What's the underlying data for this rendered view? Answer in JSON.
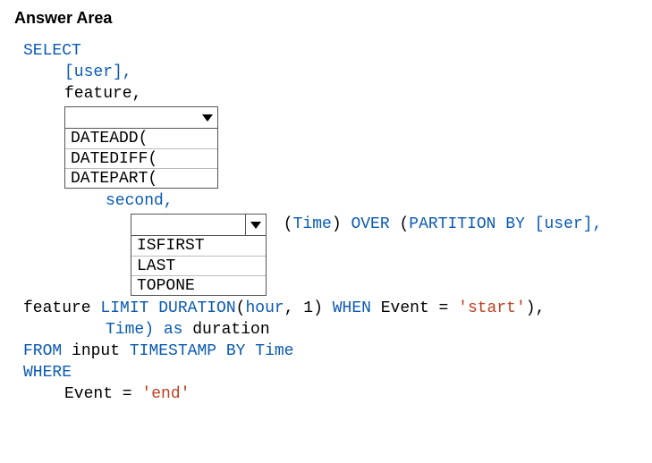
{
  "header": "Answer Area",
  "sql": {
    "select_kw": "SELECT",
    "user_col": "[user],",
    "feature_col": "feature,",
    "dd1": {
      "selected": "",
      "options": [
        "DATEADD(",
        "DATEDIFF(",
        "DATEPART("
      ]
    },
    "second_line": "second,",
    "dd2": {
      "selected": "",
      "options": [
        "ISFIRST",
        "LAST",
        "TOPONE"
      ]
    },
    "over_trail_open": " (",
    "over_trail_time": "Time",
    "over_trail_mid": ") ",
    "over_trail_over": "OVER",
    "over_trail_paren": " (",
    "over_trail_part": "PARTITION",
    "over_trail_by": " BY",
    "over_trail_user": " [user],",
    "feature_line_pre": "feature ",
    "limit_kw": "LIMIT",
    "space": " ",
    "duration_kw": "DURATION",
    "hour_args_open": "(",
    "hour_kw": "hour",
    "hour_args_rest": ", 1) ",
    "when_kw": "WHEN",
    "when_rest": " Event = ",
    "start_str": "'start'",
    "when_close": "),",
    "time_line_pre": "Time) ",
    "as_kw": "as",
    "duration_alias": " duration",
    "from_kw": "FROM",
    "from_rest": " input ",
    "ts_kw": "TIMESTAMP",
    "by_kw": " BY",
    "by_time": " Time",
    "where_kw": "WHERE",
    "where_rest": "Event = ",
    "end_str": "'end'"
  }
}
